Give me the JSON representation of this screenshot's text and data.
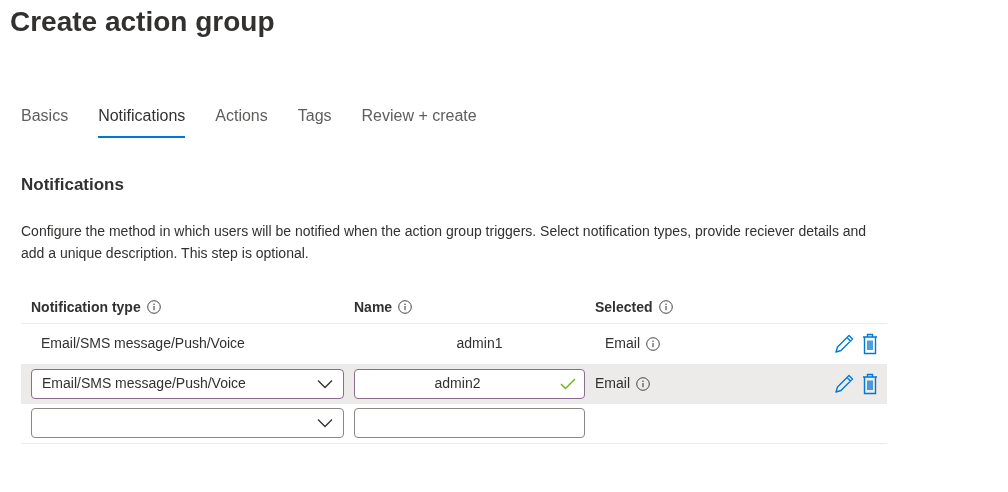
{
  "title": "Create action group",
  "tabs": [
    {
      "label": "Basics",
      "selected": false
    },
    {
      "label": "Notifications",
      "selected": true
    },
    {
      "label": "Actions",
      "selected": false
    },
    {
      "label": "Tags",
      "selected": false
    },
    {
      "label": "Review + create",
      "selected": false
    }
  ],
  "section": {
    "heading": "Notifications",
    "description": "Configure the method in which users will be notified when the action group triggers. Select notification types, provide reciever details and add a unique description. This step is optional."
  },
  "table": {
    "columns": [
      "Notification type",
      "Name",
      "Selected"
    ],
    "rows": [
      {
        "kind": "static",
        "selected": false,
        "type": "Email/SMS message/Push/Voice",
        "name": "admin1",
        "selected_methods": "Email"
      },
      {
        "kind": "editing",
        "selected": true,
        "type": "Email/SMS message/Push/Voice",
        "name": "admin2",
        "valid": true,
        "selected_methods": "Email"
      },
      {
        "kind": "empty",
        "selected": false
      }
    ]
  }
}
